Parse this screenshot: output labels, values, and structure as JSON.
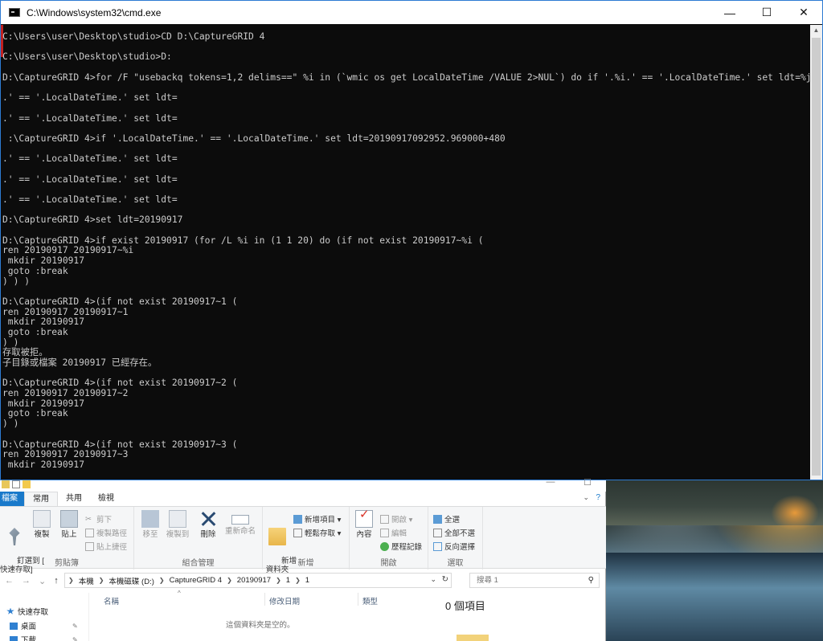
{
  "cmd": {
    "title": "C:\\Windows\\system32\\cmd.exe",
    "controls": {
      "minimize": "—",
      "maximize": "☐",
      "close": "✕"
    },
    "lines": [
      "C:\\Users\\user\\Desktop\\studio>CD D:\\CaptureGRID 4",
      "",
      "C:\\Users\\user\\Desktop\\studio>D:",
      "",
      "D:\\CaptureGRID 4>for /F \"usebackq tokens=1,2 delims==\" %i in (`wmic os get LocalDateTime /VALUE 2>NUL`) do if '.%i.' == '.LocalDateTime.' set ldt=%j",
      "",
      ".' == '.LocalDateTime.' set ldt=",
      "",
      ".' == '.LocalDateTime.' set ldt=",
      "",
      " :\\CaptureGRID 4>if '.LocalDateTime.' == '.LocalDateTime.' set ldt=20190917092952.969000+480",
      "",
      ".' == '.LocalDateTime.' set ldt=",
      "",
      ".' == '.LocalDateTime.' set ldt=",
      "",
      ".' == '.LocalDateTime.' set ldt=",
      "",
      "D:\\CaptureGRID 4>set ldt=20190917",
      "",
      "D:\\CaptureGRID 4>if exist 20190917 (for /L %i in (1 1 20) do (if not exist 20190917~%i (",
      "ren 20190917 20190917~%i",
      " mkdir 20190917",
      " goto :break",
      ") ) )",
      "",
      "D:\\CaptureGRID 4>(if not exist 20190917~1 (",
      "ren 20190917 20190917~1",
      " mkdir 20190917",
      " goto :break",
      ") )",
      "存取被拒。",
      "子目錄或檔案 20190917 已經存在。",
      "",
      "D:\\CaptureGRID 4>(if not exist 20190917~2 (",
      "ren 20190917 20190917~2",
      " mkdir 20190917",
      " goto :break",
      ") )",
      "",
      "D:\\CaptureGRID 4>(if not exist 20190917~3 (",
      "ren 20190917 20190917~3",
      " mkdir 20190917"
    ]
  },
  "explorer": {
    "controls": {
      "minimize": "—",
      "maximize": "☐"
    },
    "tabs": [
      "檔案",
      "常用",
      "共用",
      "檢視"
    ],
    "groups": {
      "clipboard": {
        "label": "剪貼簿",
        "pin_quick": "釘選到 [\n快速存取]",
        "copy": "複製",
        "paste": "貼上",
        "cut": "剪下",
        "copy_path": "複製路徑",
        "paste_shortcut": "貼上捷徑"
      },
      "organize": {
        "label": "組合管理",
        "move_to": "移至",
        "copy_to": "複製到",
        "delete": "刪除",
        "rename": "重新命名"
      },
      "new": {
        "label": "新增",
        "new_folder": "新增\n資料夾",
        "new_item": "新增項目 ▾",
        "easy_access": "輕鬆存取 ▾"
      },
      "open": {
        "label": "開啟",
        "properties": "內容",
        "open": "開啟 ▾",
        "edit": "編輯",
        "history": "歷程記錄"
      },
      "select": {
        "label": "選取",
        "select_all": "全選",
        "select_none": "全部不選",
        "invert": "反向選擇"
      }
    },
    "address": {
      "segments": [
        "本機",
        "本機磁碟 (D:)",
        "CaptureGRID 4",
        "20190917",
        "1",
        "1"
      ]
    },
    "search_placeholder": "搜尋 1",
    "nav": {
      "quick_access": "快速存取",
      "desktop": "桌面",
      "downloads": "下載"
    },
    "columns": {
      "name": "名稱",
      "date": "修改日期",
      "type": "類型"
    },
    "empty_message": "這個資料夾是空的。",
    "item_count": "0 個項目"
  },
  "colors": {
    "console_bg": "#0c0c0c",
    "console_text": "#cccccc",
    "accent": "#1979ca"
  }
}
